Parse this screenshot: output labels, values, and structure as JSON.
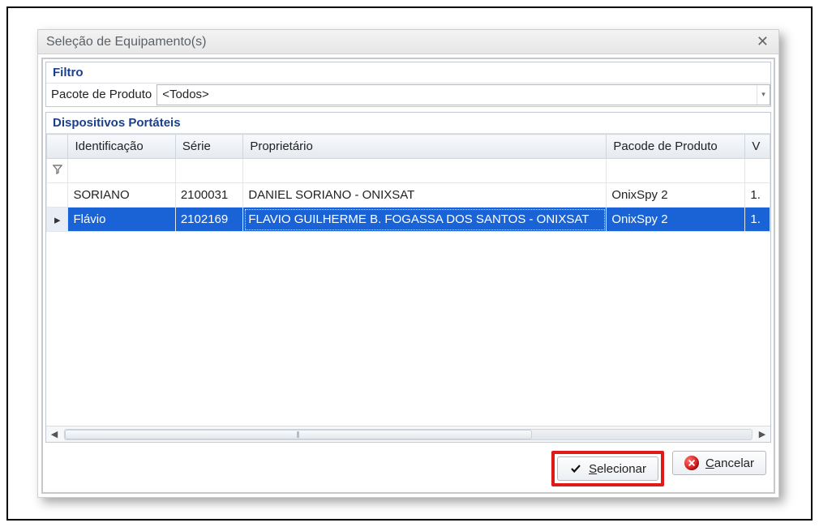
{
  "window": {
    "title": "Seleção de Equipamento(s)"
  },
  "filter_panel": {
    "title": "Filtro",
    "package_label": "Pacote de Produto",
    "package_value": "<Todos>"
  },
  "devices_panel": {
    "title": "Dispositivos Portáteis",
    "columns": {
      "identificacao": "Identificação",
      "serie": "Série",
      "proprietario": "Proprietário",
      "pacote": "Pacode de Produto",
      "v": "V"
    },
    "rows": [
      {
        "selected": false,
        "identificacao": "SORIANO",
        "serie": "2100031",
        "proprietario": "DANIEL SORIANO - ONIXSAT",
        "pacote": "OnixSpy 2",
        "v": "1."
      },
      {
        "selected": true,
        "identificacao": "Flávio",
        "serie": "2102169",
        "proprietario": "FLAVIO GUILHERME B. FOGASSA DOS SANTOS - ONIXSAT",
        "pacote": "OnixSpy 2",
        "v": "1."
      }
    ]
  },
  "footer": {
    "select_prefix": "S",
    "select_rest": "elecionar",
    "cancel_prefix": "C",
    "cancel_rest": "ancelar"
  }
}
